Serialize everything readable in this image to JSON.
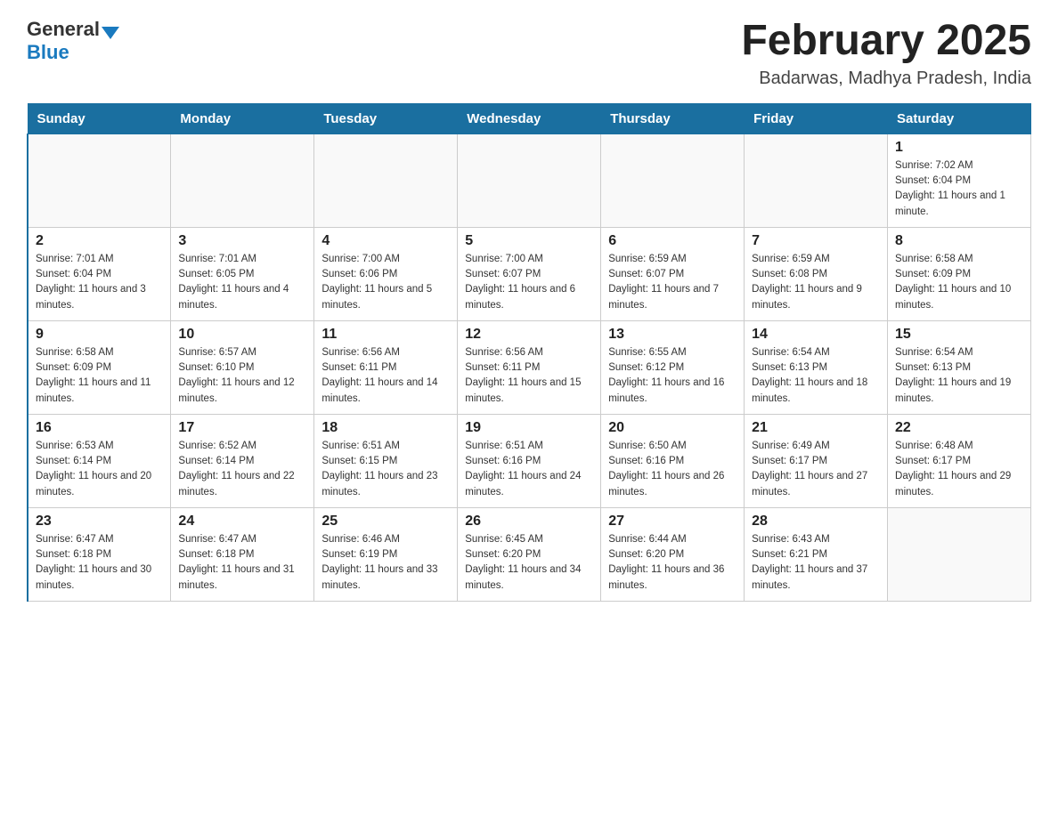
{
  "header": {
    "logo_general": "General",
    "logo_blue": "Blue",
    "title": "February 2025",
    "subtitle": "Badarwas, Madhya Pradesh, India"
  },
  "days_of_week": [
    "Sunday",
    "Monday",
    "Tuesday",
    "Wednesday",
    "Thursday",
    "Friday",
    "Saturday"
  ],
  "weeks": [
    [
      {
        "day": "",
        "info": ""
      },
      {
        "day": "",
        "info": ""
      },
      {
        "day": "",
        "info": ""
      },
      {
        "day": "",
        "info": ""
      },
      {
        "day": "",
        "info": ""
      },
      {
        "day": "",
        "info": ""
      },
      {
        "day": "1",
        "info": "Sunrise: 7:02 AM\nSunset: 6:04 PM\nDaylight: 11 hours and 1 minute."
      }
    ],
    [
      {
        "day": "2",
        "info": "Sunrise: 7:01 AM\nSunset: 6:04 PM\nDaylight: 11 hours and 3 minutes."
      },
      {
        "day": "3",
        "info": "Sunrise: 7:01 AM\nSunset: 6:05 PM\nDaylight: 11 hours and 4 minutes."
      },
      {
        "day": "4",
        "info": "Sunrise: 7:00 AM\nSunset: 6:06 PM\nDaylight: 11 hours and 5 minutes."
      },
      {
        "day": "5",
        "info": "Sunrise: 7:00 AM\nSunset: 6:07 PM\nDaylight: 11 hours and 6 minutes."
      },
      {
        "day": "6",
        "info": "Sunrise: 6:59 AM\nSunset: 6:07 PM\nDaylight: 11 hours and 7 minutes."
      },
      {
        "day": "7",
        "info": "Sunrise: 6:59 AM\nSunset: 6:08 PM\nDaylight: 11 hours and 9 minutes."
      },
      {
        "day": "8",
        "info": "Sunrise: 6:58 AM\nSunset: 6:09 PM\nDaylight: 11 hours and 10 minutes."
      }
    ],
    [
      {
        "day": "9",
        "info": "Sunrise: 6:58 AM\nSunset: 6:09 PM\nDaylight: 11 hours and 11 minutes."
      },
      {
        "day": "10",
        "info": "Sunrise: 6:57 AM\nSunset: 6:10 PM\nDaylight: 11 hours and 12 minutes."
      },
      {
        "day": "11",
        "info": "Sunrise: 6:56 AM\nSunset: 6:11 PM\nDaylight: 11 hours and 14 minutes."
      },
      {
        "day": "12",
        "info": "Sunrise: 6:56 AM\nSunset: 6:11 PM\nDaylight: 11 hours and 15 minutes."
      },
      {
        "day": "13",
        "info": "Sunrise: 6:55 AM\nSunset: 6:12 PM\nDaylight: 11 hours and 16 minutes."
      },
      {
        "day": "14",
        "info": "Sunrise: 6:54 AM\nSunset: 6:13 PM\nDaylight: 11 hours and 18 minutes."
      },
      {
        "day": "15",
        "info": "Sunrise: 6:54 AM\nSunset: 6:13 PM\nDaylight: 11 hours and 19 minutes."
      }
    ],
    [
      {
        "day": "16",
        "info": "Sunrise: 6:53 AM\nSunset: 6:14 PM\nDaylight: 11 hours and 20 minutes."
      },
      {
        "day": "17",
        "info": "Sunrise: 6:52 AM\nSunset: 6:14 PM\nDaylight: 11 hours and 22 minutes."
      },
      {
        "day": "18",
        "info": "Sunrise: 6:51 AM\nSunset: 6:15 PM\nDaylight: 11 hours and 23 minutes."
      },
      {
        "day": "19",
        "info": "Sunrise: 6:51 AM\nSunset: 6:16 PM\nDaylight: 11 hours and 24 minutes."
      },
      {
        "day": "20",
        "info": "Sunrise: 6:50 AM\nSunset: 6:16 PM\nDaylight: 11 hours and 26 minutes."
      },
      {
        "day": "21",
        "info": "Sunrise: 6:49 AM\nSunset: 6:17 PM\nDaylight: 11 hours and 27 minutes."
      },
      {
        "day": "22",
        "info": "Sunrise: 6:48 AM\nSunset: 6:17 PM\nDaylight: 11 hours and 29 minutes."
      }
    ],
    [
      {
        "day": "23",
        "info": "Sunrise: 6:47 AM\nSunset: 6:18 PM\nDaylight: 11 hours and 30 minutes."
      },
      {
        "day": "24",
        "info": "Sunrise: 6:47 AM\nSunset: 6:18 PM\nDaylight: 11 hours and 31 minutes."
      },
      {
        "day": "25",
        "info": "Sunrise: 6:46 AM\nSunset: 6:19 PM\nDaylight: 11 hours and 33 minutes."
      },
      {
        "day": "26",
        "info": "Sunrise: 6:45 AM\nSunset: 6:20 PM\nDaylight: 11 hours and 34 minutes."
      },
      {
        "day": "27",
        "info": "Sunrise: 6:44 AM\nSunset: 6:20 PM\nDaylight: 11 hours and 36 minutes."
      },
      {
        "day": "28",
        "info": "Sunrise: 6:43 AM\nSunset: 6:21 PM\nDaylight: 11 hours and 37 minutes."
      },
      {
        "day": "",
        "info": ""
      }
    ]
  ]
}
